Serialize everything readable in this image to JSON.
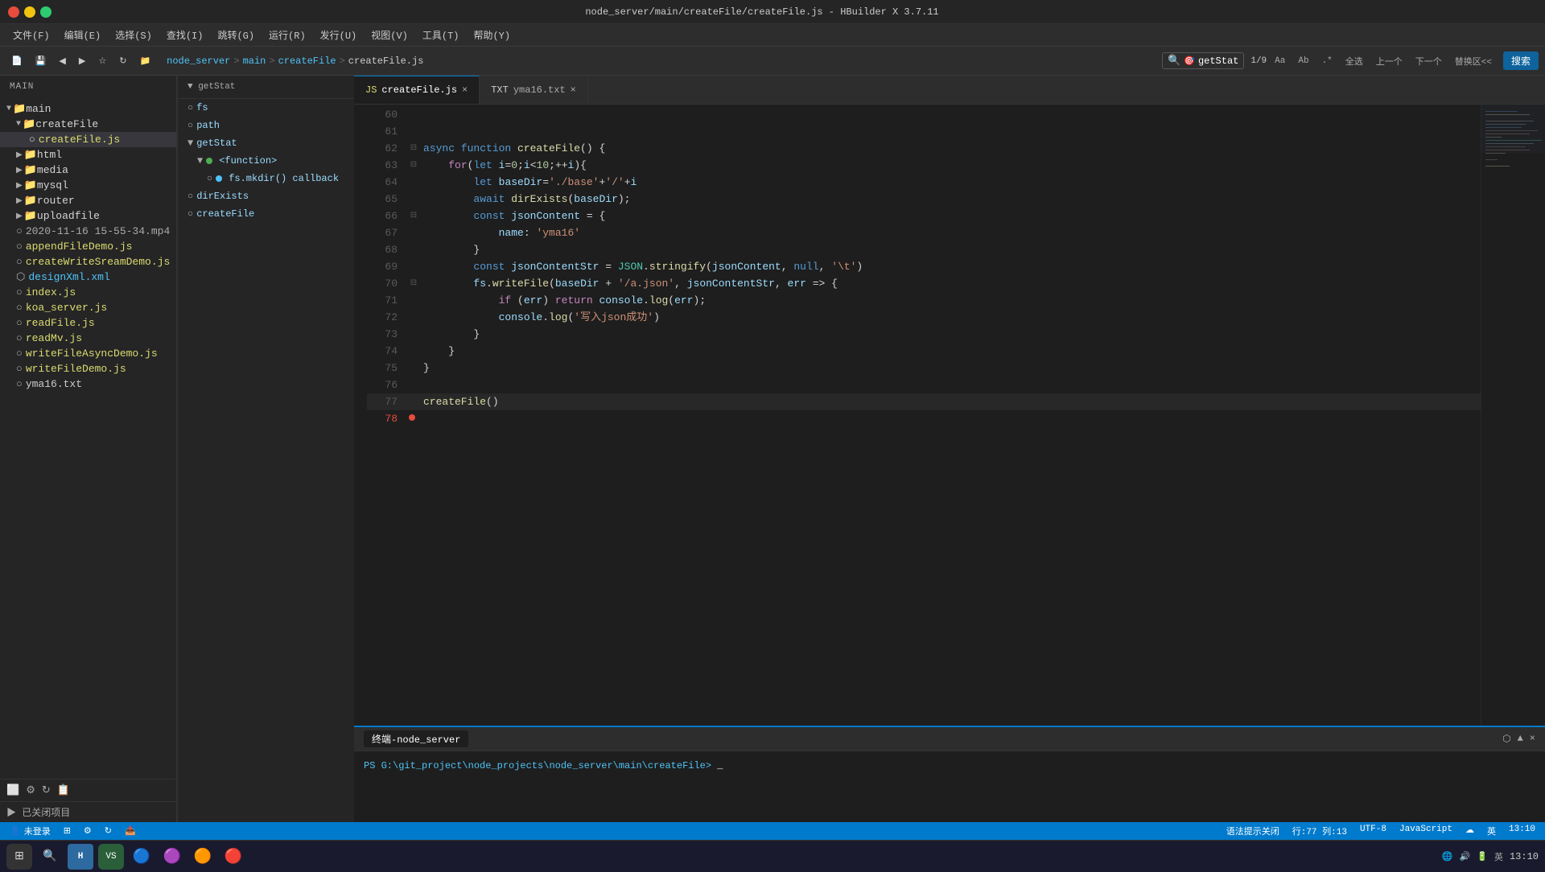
{
  "window": {
    "title": "node_server/main/createFile/createFile.js - HBuilder X 3.7.11",
    "controls": [
      "minimize",
      "maximize",
      "close"
    ]
  },
  "menubar": {
    "items": [
      "文件(F)",
      "编辑(E)",
      "选择(S)",
      "查找(I)",
      "跳转(G)",
      "运行(R)",
      "发行(U)",
      "视图(V)",
      "工具(T)",
      "帮助(Y)"
    ]
  },
  "toolbar": {
    "breadcrumb": [
      "node_server",
      ">",
      "main",
      ">",
      "createFile",
      ">",
      "createFile.js"
    ],
    "search_placeholder": "搜索",
    "search_current": "getStat",
    "search_options": [
      "1/9",
      "Aa",
      "Ab",
      ".*",
      "全选",
      "上一个",
      "下一个",
      "替换区<<"
    ],
    "search_action": "搜索"
  },
  "tabs": [
    {
      "label": "createFile.js",
      "active": true
    },
    {
      "label": "yma16.txt",
      "active": false
    }
  ],
  "file_tree": {
    "root": "main",
    "items": [
      {
        "type": "folder",
        "name": "main",
        "level": 0,
        "expanded": true
      },
      {
        "type": "folder",
        "name": "createFile",
        "level": 1,
        "expanded": true
      },
      {
        "type": "file",
        "name": "createFile.js",
        "level": 2,
        "filetype": "js"
      },
      {
        "type": "folder",
        "name": "html",
        "level": 1,
        "expanded": false
      },
      {
        "type": "folder",
        "name": "media",
        "level": 1,
        "expanded": false
      },
      {
        "type": "folder",
        "name": "mysql",
        "level": 1,
        "expanded": false
      },
      {
        "type": "folder",
        "name": "router",
        "level": 1,
        "expanded": false
      },
      {
        "type": "folder",
        "name": "uploadfile",
        "level": 1,
        "expanded": false
      },
      {
        "type": "file",
        "name": "2020-11-16 15-55-34.mp4",
        "level": 1,
        "filetype": "media"
      },
      {
        "type": "file",
        "name": "appendFileDemo.js",
        "level": 1,
        "filetype": "js"
      },
      {
        "type": "file",
        "name": "createWriteSreamDemo.js",
        "level": 1,
        "filetype": "js"
      },
      {
        "type": "file",
        "name": "designXml.xml",
        "level": 1,
        "filetype": "xml"
      },
      {
        "type": "file",
        "name": "index.js",
        "level": 1,
        "filetype": "js"
      },
      {
        "type": "file",
        "name": "koa_server.js",
        "level": 1,
        "filetype": "js"
      },
      {
        "type": "file",
        "name": "readFile.js",
        "level": 1,
        "filetype": "js"
      },
      {
        "type": "file",
        "name": "readMv.js",
        "level": 1,
        "filetype": "js"
      },
      {
        "type": "file",
        "name": "writeFileAsyncDemo.js",
        "level": 1,
        "filetype": "js"
      },
      {
        "type": "file",
        "name": "writeFileDemo.js",
        "level": 1,
        "filetype": "js"
      },
      {
        "type": "file",
        "name": "yma16.txt",
        "level": 1,
        "filetype": "txt"
      }
    ]
  },
  "outline": {
    "title": "getStat",
    "items": [
      {
        "name": "fs",
        "level": 0
      },
      {
        "name": "path",
        "level": 0
      },
      {
        "name": "getStat",
        "level": 0,
        "expanded": true
      },
      {
        "name": "<function>",
        "level": 1
      },
      {
        "name": "fs.mkdir() callback",
        "level": 2
      },
      {
        "name": "dirExists",
        "level": 0
      },
      {
        "name": "createFile",
        "level": 0
      }
    ]
  },
  "code": {
    "lines": [
      {
        "num": 60,
        "content": "",
        "fold": false
      },
      {
        "num": 61,
        "content": "",
        "fold": false
      },
      {
        "num": 62,
        "content": "async function createFile() {",
        "fold": true,
        "tokens": [
          {
            "t": "kw",
            "v": "async "
          },
          {
            "t": "kw",
            "v": "function "
          },
          {
            "t": "fn",
            "v": "createFile"
          },
          {
            "t": "punct",
            "v": "() {"
          }
        ]
      },
      {
        "num": 63,
        "content": "    for(let i=0;i<10;++i){",
        "fold": true,
        "tokens": [
          {
            "t": "plain",
            "v": "    "
          },
          {
            "t": "kw2",
            "v": "for"
          },
          {
            "t": "punct",
            "v": "("
          },
          {
            "t": "kw",
            "v": "let "
          },
          {
            "t": "var",
            "v": "i"
          },
          {
            "t": "op",
            "v": "="
          },
          {
            "t": "num",
            "v": "0"
          },
          {
            "t": "punct",
            "v": ";"
          },
          {
            "t": "var",
            "v": "i"
          },
          {
            "t": "op",
            "v": "<"
          },
          {
            "t": "num",
            "v": "10"
          },
          {
            "t": "punct",
            "v": ";++"
          },
          {
            "t": "var",
            "v": "i"
          },
          {
            "t": "punct",
            "v": "){"
          }
        ]
      },
      {
        "num": 64,
        "content": "        let baseDir='./base'+'/'+i",
        "fold": false,
        "tokens": [
          {
            "t": "plain",
            "v": "        "
          },
          {
            "t": "kw",
            "v": "let "
          },
          {
            "t": "var",
            "v": "baseDir"
          },
          {
            "t": "op",
            "v": "="
          },
          {
            "t": "str",
            "v": "'./base'"
          },
          {
            "t": "op",
            "v": "+"
          },
          {
            "t": "str",
            "v": "'/'"
          },
          {
            "t": "op",
            "v": "+"
          },
          {
            "t": "var",
            "v": "i"
          }
        ]
      },
      {
        "num": 65,
        "content": "        await dirExists(baseDir);",
        "fold": false,
        "tokens": [
          {
            "t": "plain",
            "v": "        "
          },
          {
            "t": "kw",
            "v": "await "
          },
          {
            "t": "fn",
            "v": "dirExists"
          },
          {
            "t": "punct",
            "v": "("
          },
          {
            "t": "var",
            "v": "baseDir"
          },
          {
            "t": "punct",
            "v": ");"
          }
        ]
      },
      {
        "num": 66,
        "content": "        const jsonContent = {",
        "fold": true,
        "tokens": [
          {
            "t": "plain",
            "v": "        "
          },
          {
            "t": "kw",
            "v": "const "
          },
          {
            "t": "var",
            "v": "jsonContent"
          },
          {
            "t": "op",
            "v": " = "
          },
          {
            "t": "punct",
            "v": "{"
          }
        ]
      },
      {
        "num": 67,
        "content": "            name: 'yma16'",
        "fold": false,
        "tokens": [
          {
            "t": "plain",
            "v": "            "
          },
          {
            "t": "prop",
            "v": "name"
          },
          {
            "t": "punct",
            "v": ": "
          },
          {
            "t": "str",
            "v": "'yma16'"
          }
        ]
      },
      {
        "num": 68,
        "content": "        }",
        "fold": false,
        "tokens": [
          {
            "t": "plain",
            "v": "        "
          },
          {
            "t": "punct",
            "v": "}"
          }
        ]
      },
      {
        "num": 69,
        "content": "        const jsonContentStr = JSON.stringify(jsonContent, null, '\\t')",
        "fold": false,
        "tokens": [
          {
            "t": "plain",
            "v": "        "
          },
          {
            "t": "kw",
            "v": "const "
          },
          {
            "t": "var",
            "v": "jsonContentStr"
          },
          {
            "t": "op",
            "v": " = "
          },
          {
            "t": "cls",
            "v": "JSON"
          },
          {
            "t": "punct",
            "v": "."
          },
          {
            "t": "fn",
            "v": "stringify"
          },
          {
            "t": "punct",
            "v": "("
          },
          {
            "t": "var",
            "v": "jsonContent"
          },
          {
            "t": "punct",
            "v": ", "
          },
          {
            "t": "kw",
            "v": "null"
          },
          {
            "t": "punct",
            "v": ", "
          },
          {
            "t": "str",
            "v": "'\\t'"
          },
          {
            "t": "punct",
            "v": ")"
          }
        ]
      },
      {
        "num": 70,
        "content": "        fs.writeFile(baseDir + '/a.json', jsonContentStr, err => {",
        "fold": true,
        "tokens": [
          {
            "t": "plain",
            "v": "        "
          },
          {
            "t": "var",
            "v": "fs"
          },
          {
            "t": "punct",
            "v": "."
          },
          {
            "t": "fn",
            "v": "writeFile"
          },
          {
            "t": "punct",
            "v": "("
          },
          {
            "t": "var",
            "v": "baseDir"
          },
          {
            "t": "op",
            "v": " + "
          },
          {
            "t": "str",
            "v": "'/a.json'"
          },
          {
            "t": "punct",
            "v": ", "
          },
          {
            "t": "var",
            "v": "jsonContentStr"
          },
          {
            "t": "punct",
            "v": ", "
          },
          {
            "t": "var",
            "v": "err"
          },
          {
            "t": "op",
            "v": " => "
          },
          {
            "t": "punct",
            "v": "{"
          }
        ]
      },
      {
        "num": 71,
        "content": "            if (err) return console.log(err);",
        "fold": false,
        "tokens": [
          {
            "t": "plain",
            "v": "            "
          },
          {
            "t": "kw2",
            "v": "if "
          },
          {
            "t": "punct",
            "v": "("
          },
          {
            "t": "var",
            "v": "err"
          },
          {
            "t": "punct",
            "v": ") "
          },
          {
            "t": "kw2",
            "v": "return "
          },
          {
            "t": "var",
            "v": "console"
          },
          {
            "t": "punct",
            "v": "."
          },
          {
            "t": "fn",
            "v": "log"
          },
          {
            "t": "punct",
            "v": "("
          },
          {
            "t": "var",
            "v": "err"
          },
          {
            "t": "punct",
            "v": ");"
          }
        ]
      },
      {
        "num": 72,
        "content": "            console.log('写入json成功')",
        "fold": false,
        "tokens": [
          {
            "t": "plain",
            "v": "            "
          },
          {
            "t": "var",
            "v": "console"
          },
          {
            "t": "punct",
            "v": "."
          },
          {
            "t": "fn",
            "v": "log"
          },
          {
            "t": "punct",
            "v": "("
          },
          {
            "t": "str",
            "v": "'写入json成功'"
          },
          {
            "t": "punct",
            "v": ")"
          }
        ]
      },
      {
        "num": 73,
        "content": "        })",
        "fold": false,
        "tokens": [
          {
            "t": "plain",
            "v": "        "
          },
          {
            "t": "punct",
            "v": "}"
          }
        ]
      },
      {
        "num": 74,
        "content": "    }",
        "fold": false,
        "tokens": [
          {
            "t": "plain",
            "v": "    "
          },
          {
            "t": "punct",
            "v": "}"
          }
        ]
      },
      {
        "num": 75,
        "content": "}",
        "fold": false,
        "tokens": [
          {
            "t": "punct",
            "v": "}"
          }
        ]
      },
      {
        "num": 76,
        "content": "",
        "fold": false
      },
      {
        "num": 77,
        "content": "createFile()",
        "fold": false,
        "tokens": [
          {
            "t": "fn",
            "v": "createFile"
          },
          {
            "t": "punct",
            "v": "()"
          }
        ]
      },
      {
        "num": 78,
        "content": "",
        "fold": false
      }
    ]
  },
  "terminal": {
    "tab_label": "终端-node_server",
    "path": "PS G:\\git_project\\node_projects\\node_server\\main\\createFile>",
    "cursor": "_"
  },
  "statusbar": {
    "hint": "语法提示关闭",
    "position": "行:77  列:13",
    "encoding": "UTF-8",
    "language": "JavaScript",
    "user": "未登录"
  },
  "taskbar": {
    "time": "13:10",
    "icons": [
      "⊞",
      "🔍",
      "⚙",
      "💬",
      "🟢",
      "🔵",
      "🟣",
      "🟠",
      "🔴"
    ]
  }
}
